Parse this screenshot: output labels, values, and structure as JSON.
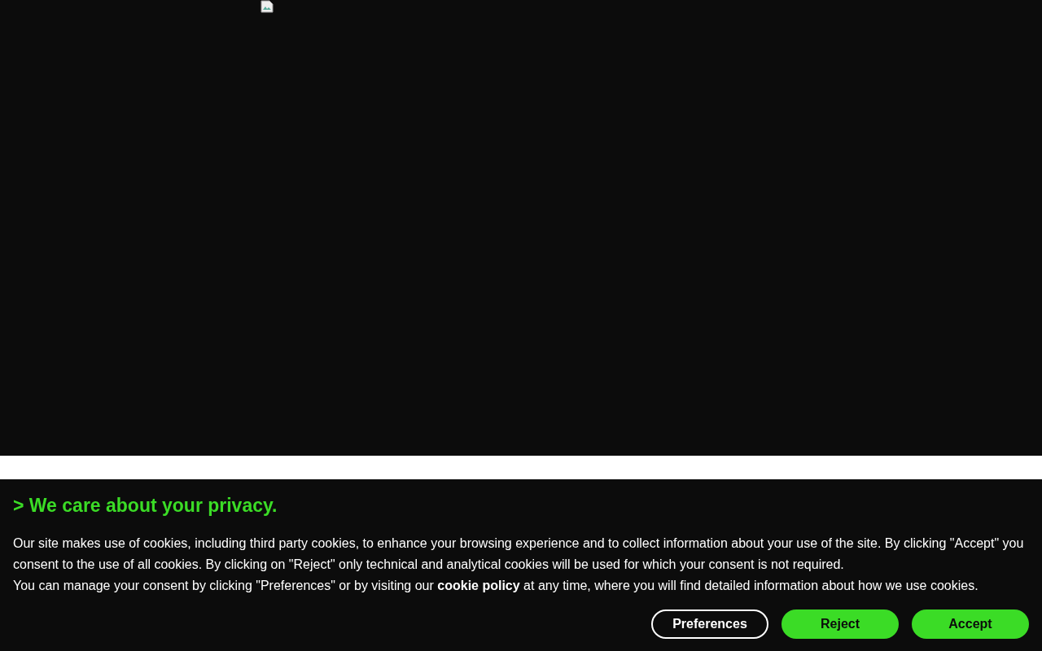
{
  "banner": {
    "title": "> We care about your privacy.",
    "paragraphs": [
      {
        "text": "Our site makes use of cookies, including third party cookies, to enhance your browsing experience and to collect information about your use of the site. By clicking \"Accept\" you consent to the use of all cookies. By clicking on \"Reject\" only technical and analytical cookies will be used for which your consent is not required."
      },
      {
        "text": "You can manage your consent by clicking \"Preferences\" or by visiting our",
        "link": "cookie policy",
        "after": "at any time, where you will find detailed information about how we use cookies."
      }
    ],
    "buttons": [
      {
        "label": "Preferences",
        "kind": "outline"
      },
      {
        "label": "Reject",
        "kind": "filled"
      },
      {
        "label": "Accept",
        "kind": "filled"
      }
    ]
  }
}
